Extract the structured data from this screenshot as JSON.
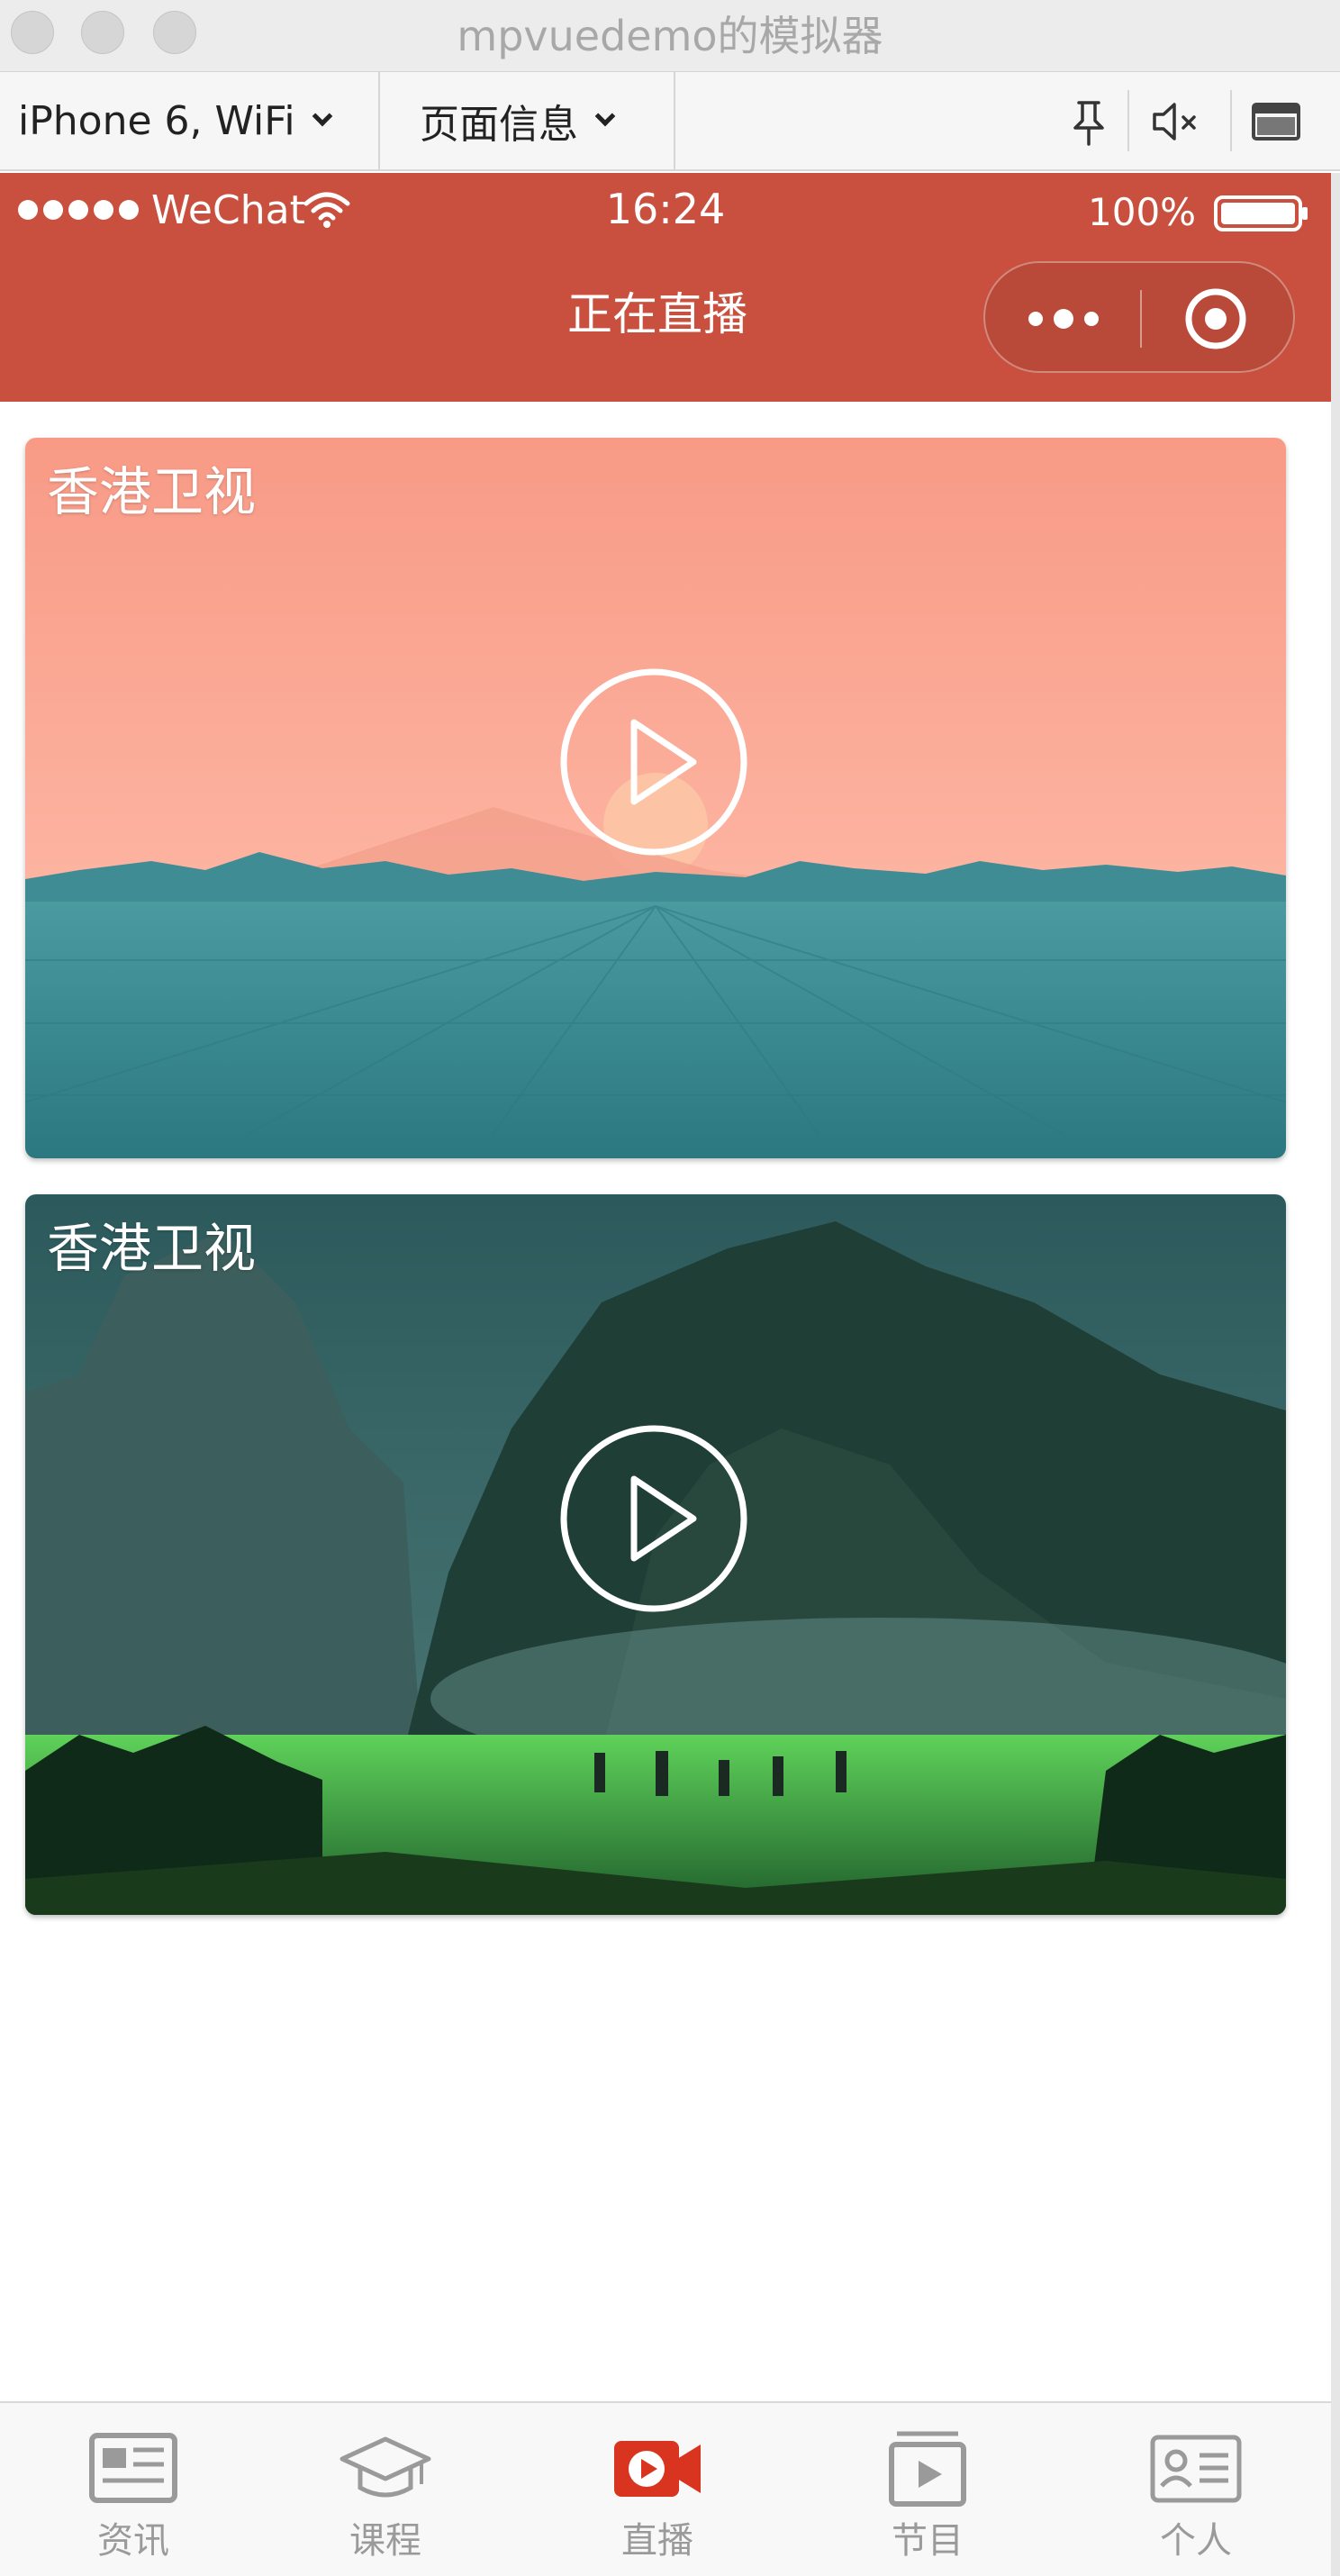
{
  "window": {
    "title": "mpvuedemo的模拟器"
  },
  "toolbar": {
    "device_select": "iPhone 6, WiFi",
    "page_info_select": "页面信息",
    "icons": [
      "pin-icon",
      "mute-icon",
      "panel-icon"
    ]
  },
  "statusbar": {
    "carrier": "WeChat",
    "time": "16:24",
    "battery": "100%"
  },
  "navbar": {
    "title": "正在直播",
    "bg_color": "#c9503e"
  },
  "cards": [
    {
      "title": "香港卫视",
      "scene": "sunset-sea"
    },
    {
      "title": "香港卫视",
      "scene": "misty-mountain-field"
    }
  ],
  "tabbar": {
    "active_color": "#d9341f",
    "items": [
      {
        "label": "资讯",
        "icon": "news-icon"
      },
      {
        "label": "课程",
        "icon": "graduation-cap-icon"
      },
      {
        "label": "直播",
        "icon": "video-camera-icon",
        "active": true
      },
      {
        "label": "节目",
        "icon": "play-board-icon"
      },
      {
        "label": "个人",
        "icon": "id-card-icon"
      }
    ]
  }
}
